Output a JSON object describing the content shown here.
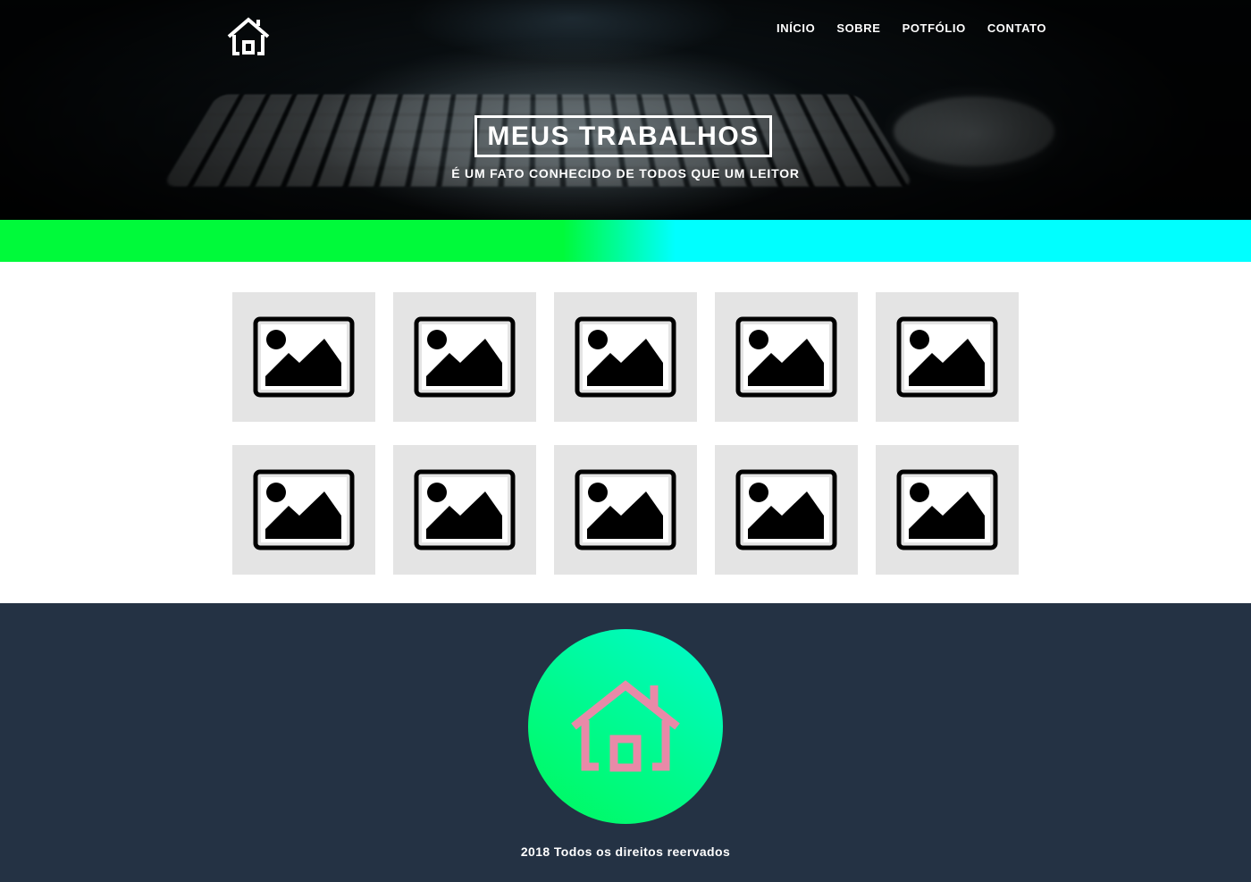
{
  "header": {
    "logo_icon": "house-icon",
    "nav": [
      {
        "label": "INÍCIO"
      },
      {
        "label": "SOBRE"
      },
      {
        "label": "POTFÓLIO"
      },
      {
        "label": "CONTATO"
      }
    ]
  },
  "hero": {
    "title": "MEUS TRABALHOS",
    "subtitle": "É UM FATO CONHECIDO DE TODOS QUE UM LEITOR"
  },
  "gradient_bar": {
    "colors": [
      "#00fa3a",
      "#00ffff"
    ]
  },
  "portfolio": {
    "tile_icon": "image-placeholder-icon",
    "items": [
      {
        "icon": "image-placeholder-icon"
      },
      {
        "icon": "image-placeholder-icon"
      },
      {
        "icon": "image-placeholder-icon"
      },
      {
        "icon": "image-placeholder-icon"
      },
      {
        "icon": "image-placeholder-icon"
      },
      {
        "icon": "image-placeholder-icon"
      },
      {
        "icon": "image-placeholder-icon"
      },
      {
        "icon": "image-placeholder-icon"
      },
      {
        "icon": "image-placeholder-icon"
      },
      {
        "icon": "image-placeholder-icon"
      }
    ]
  },
  "footer": {
    "logo_icon": "house-icon",
    "logo_color": "#e88aa8",
    "background": "#243244",
    "copyright": "2018 Todos os direitos reervados"
  }
}
